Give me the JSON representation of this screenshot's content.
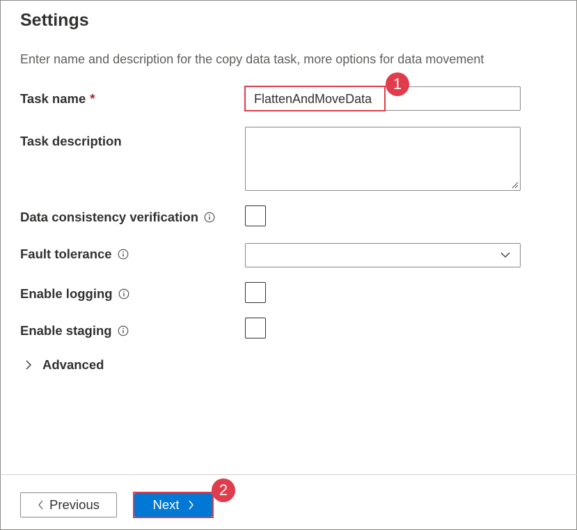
{
  "header": {
    "title": "Settings",
    "subtitle": "Enter name and description for the copy data task, more options for data movement"
  },
  "fields": {
    "task_name": {
      "label": "Task name",
      "required_marker": "*",
      "value": "FlattenAndMoveData"
    },
    "task_description": {
      "label": "Task description",
      "value": ""
    },
    "data_consistency": {
      "label": "Data consistency verification",
      "checked": false
    },
    "fault_tolerance": {
      "label": "Fault tolerance",
      "selected": ""
    },
    "enable_logging": {
      "label": "Enable logging",
      "checked": false
    },
    "enable_staging": {
      "label": "Enable staging",
      "checked": false
    }
  },
  "advanced": {
    "label": "Advanced",
    "expanded": false
  },
  "footer": {
    "previous_label": "Previous",
    "next_label": "Next"
  },
  "annotations": {
    "badge_1": "1",
    "badge_2": "2"
  },
  "icons": {
    "info": "info-icon",
    "chevron_down": "chevron-down-icon",
    "chevron_right": "chevron-right-icon",
    "chevron_left": "chevron-left-icon"
  },
  "colors": {
    "primary": "#0078d4",
    "annotation": "#e03c4b",
    "required": "#a4262c",
    "text": "#323130",
    "muted_text": "#605e5c"
  }
}
